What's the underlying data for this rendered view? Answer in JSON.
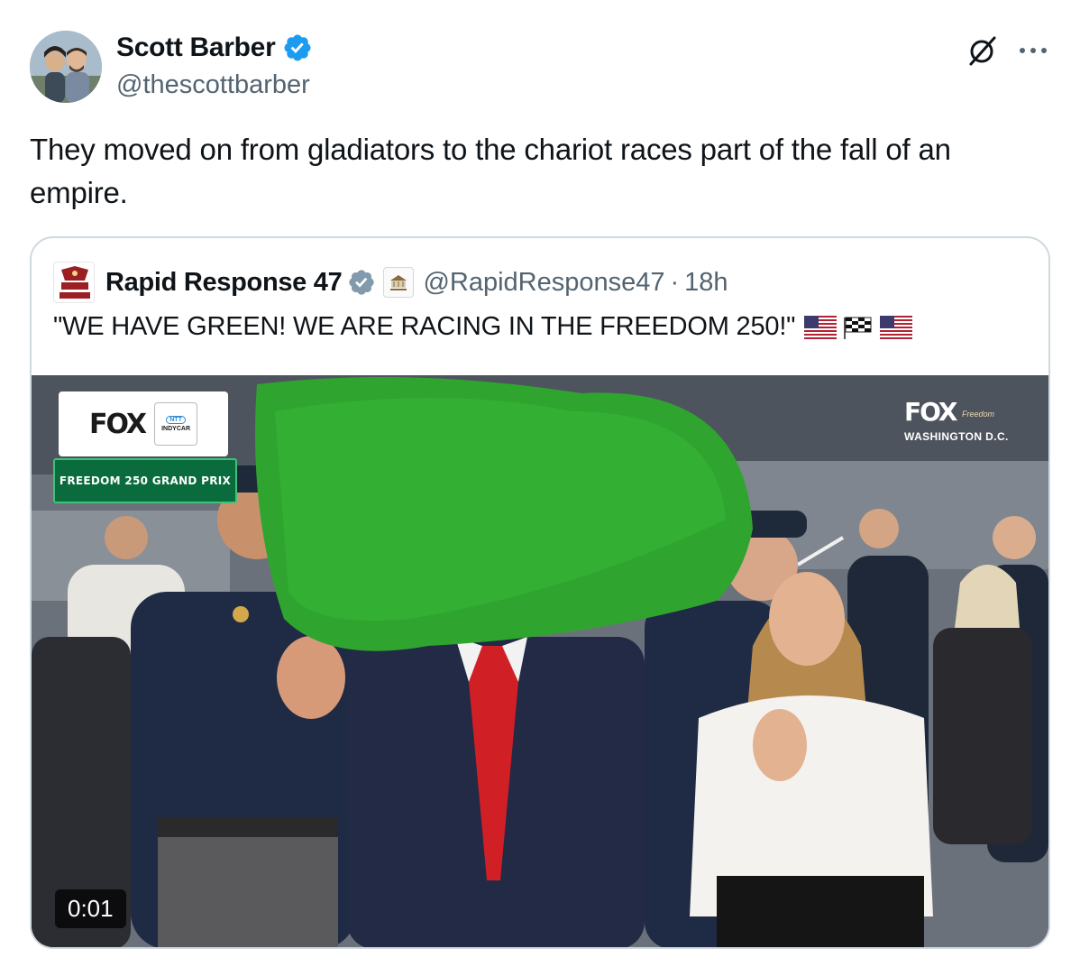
{
  "author": {
    "display_name": "Scott Barber",
    "handle": "@thescottbarber",
    "verified": true
  },
  "actions": {
    "grok_icon": "grok-icon",
    "more_icon": "more-icon",
    "more_label": "···"
  },
  "tweet": {
    "text": "They moved on from gladiators to the chariot races part of the fall of an empire."
  },
  "quote": {
    "display_name": "Rapid Response 47",
    "handle": "@RapidResponse47",
    "separator": "·",
    "time": "18h",
    "avatar_text": "RAPID RESPONSE",
    "affiliate_text": "WHITE HOUSE",
    "text": "\"WE HAVE GREEN! WE ARE RACING IN THE FREEDOM 250!\"",
    "emojis": [
      "us-flag",
      "checkered-flag",
      "us-flag"
    ],
    "video": {
      "timestamp": "0:01",
      "overlay_left_brand": "FOX",
      "overlay_left_ntt": "NTT",
      "overlay_left_series": "INDYCAR",
      "overlay_left_banner": "FREEDOM 250 GRAND PRIX",
      "overlay_right_brand": "FOX",
      "overlay_right_sub": "Freedom",
      "overlay_right_location": "WASHINGTON D.C."
    }
  },
  "colors": {
    "verified_blue": "#1d9bf0",
    "quote_verified": "#829aab",
    "text_primary": "#0f1419",
    "text_secondary": "#536471",
    "border": "#cfd9de"
  }
}
